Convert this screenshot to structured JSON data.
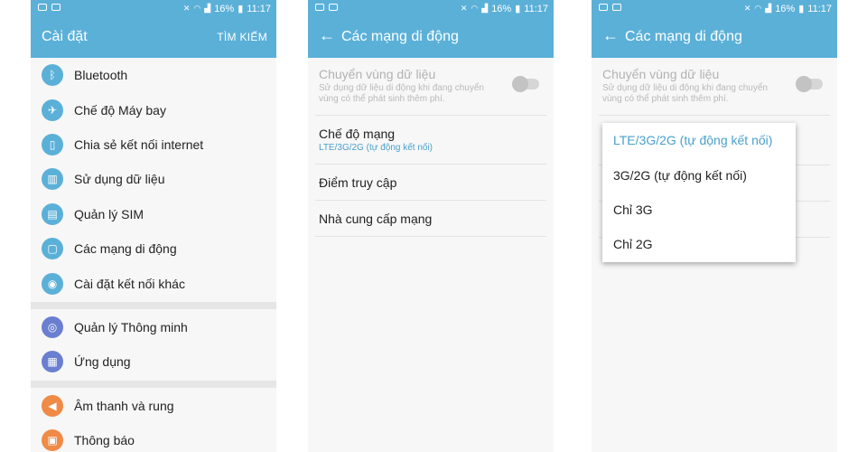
{
  "status": {
    "battery": "16%",
    "time": "11:17"
  },
  "screen1": {
    "title": "Cài đặt",
    "search": "TÌM KIẾM",
    "items": [
      {
        "label": "Bluetooth",
        "icon": "bluetooth-icon"
      },
      {
        "label": "Chế độ Máy bay",
        "icon": "airplane-icon"
      },
      {
        "label": "Chia sẻ kết nối internet",
        "icon": "tethering-icon"
      },
      {
        "label": "Sử dụng dữ liệu",
        "icon": "data-usage-icon"
      },
      {
        "label": "Quản lý SIM",
        "icon": "sim-icon"
      },
      {
        "label": "Các mạng di động",
        "icon": "mobile-network-icon"
      },
      {
        "label": "Cài đặt kết nối khác",
        "icon": "more-connection-icon"
      },
      {
        "label": "Quản lý Thông minh",
        "icon": "smart-manager-icon"
      },
      {
        "label": "Ứng dụng",
        "icon": "apps-icon"
      },
      {
        "label": "Âm thanh và rung",
        "icon": "sound-icon"
      },
      {
        "label": "Thông báo",
        "icon": "notification-icon"
      }
    ]
  },
  "screen2": {
    "title": "Các mạng di động",
    "roaming_title": "Chuyển vùng dữ liệu",
    "roaming_desc": "Sử dụng dữ liệu di động khi đang chuyển vùng có thể phát sinh thêm phí.",
    "network_mode_title": "Chế độ mạng",
    "network_mode_value": "LTE/3G/2G (tự động kết nối)",
    "apn": "Điểm truy cập",
    "operators": "Nhà cung cấp mạng"
  },
  "screen3": {
    "title": "Các mạng di động",
    "options": [
      "LTE/3G/2G (tự động kết nối)",
      "3G/2G (tự động kết nối)",
      "Chỉ 3G",
      "Chỉ 2G"
    ]
  },
  "colors": {
    "accent": "#5bb0d8",
    "selected": "#4aa0cc"
  }
}
